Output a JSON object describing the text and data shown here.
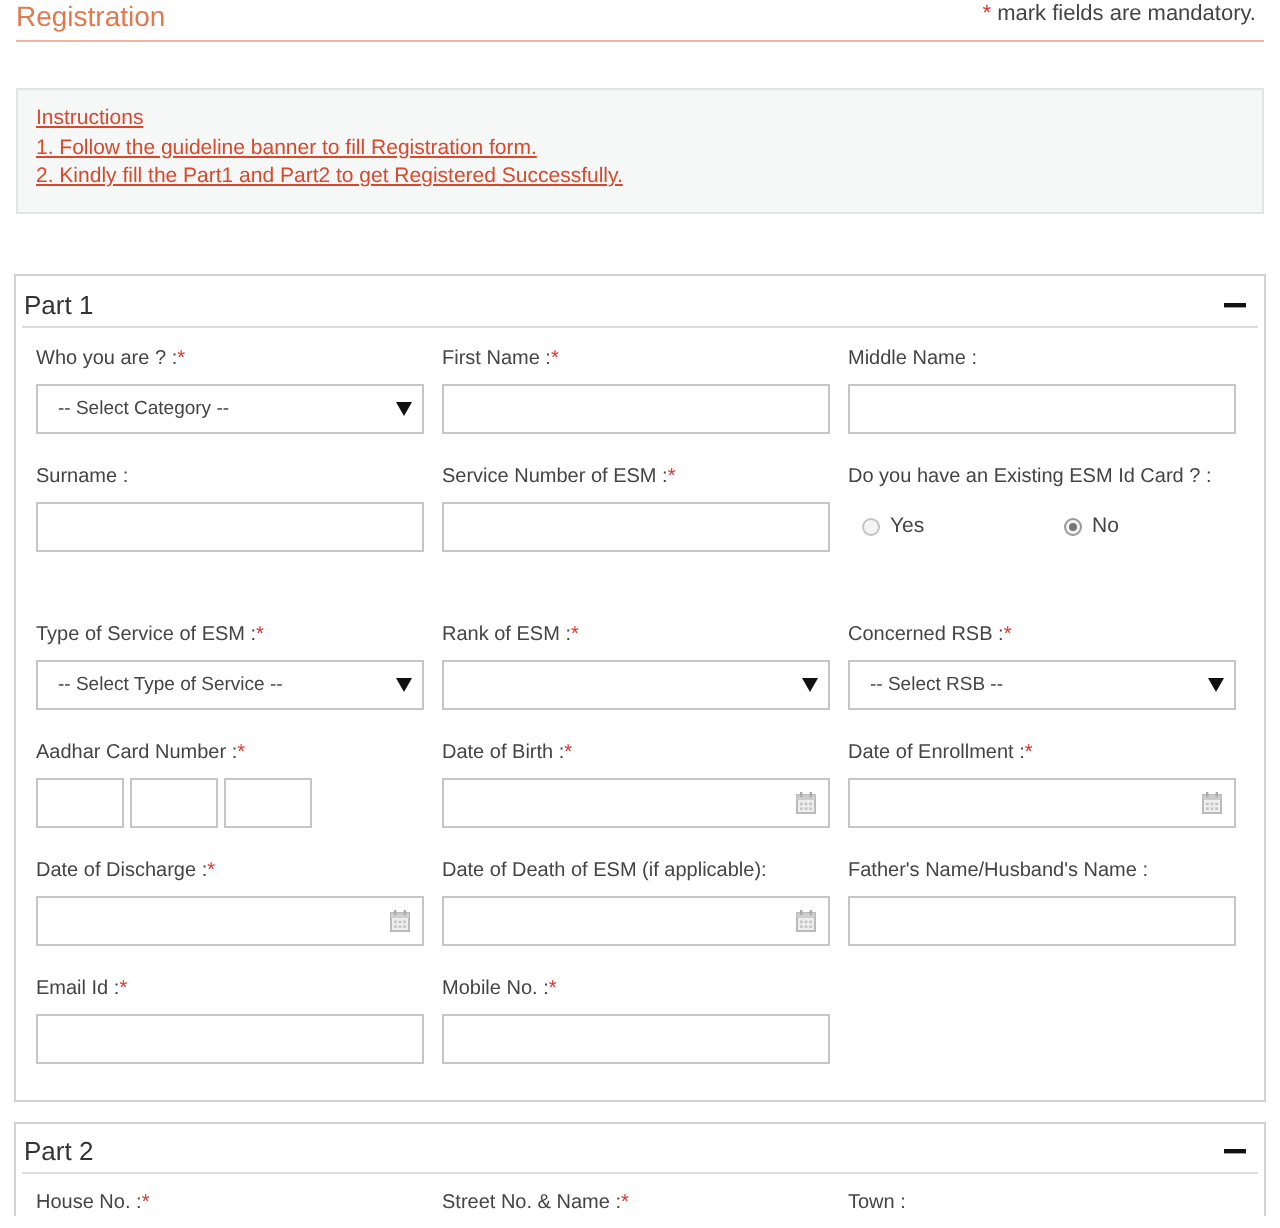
{
  "header": {
    "title": "Registration",
    "note": {
      "mark": "*",
      "text": "mark fields are mandatory."
    }
  },
  "instructions": {
    "title": "Instructions",
    "items": [
      "1. Follow the guideline banner to fill Registration form.",
      "2. Kindly fill the Part1 and Part2 to get Registered Successfully."
    ]
  },
  "parts": [
    {
      "title": "Part 1",
      "expanded": true,
      "fields": [
        {
          "label": "Who you are ? :",
          "mark": "*",
          "kind": "select",
          "value": "-- Select Category --"
        },
        {
          "label": "First Name :",
          "mark": "*",
          "kind": "text"
        },
        {
          "label": "Middle Name :",
          "kind": "text"
        },
        {
          "label": "Surname :",
          "kind": "text"
        },
        {
          "label": "Service Number of ESM :",
          "mark": "*",
          "kind": "text"
        },
        {
          "label": "Do you have an Existing ESM Id Card ? :",
          "kind": "radio",
          "options": [
            {
              "label": "Yes",
              "selected": false
            },
            {
              "label": "No",
              "selected": true
            }
          ]
        },
        {
          "label": "Type of Service of ESM :",
          "mark": "*",
          "kind": "select",
          "value": "-- Select Type of Service --"
        },
        {
          "label": "Rank of ESM :",
          "mark": "*",
          "kind": "select"
        },
        {
          "label": "Concerned RSB :",
          "mark": "*",
          "kind": "select",
          "value": "-- Select RSB --"
        },
        {
          "label": "Aadhar Card Number :",
          "mark": "*",
          "kind": "split"
        },
        {
          "label": "Date of Birth :",
          "mark": "*",
          "kind": "date"
        },
        {
          "label": "Date of Enrollment :",
          "mark": "*",
          "kind": "date"
        },
        {
          "label": "Date of Discharge :",
          "mark": "*",
          "kind": "date"
        },
        {
          "label": "Date of Death of ESM (if applicable):",
          "kind": "date"
        },
        {
          "label": "Father's Name/Husband's Name :",
          "kind": "text"
        },
        {
          "label": "Email Id :",
          "mark": "*",
          "kind": "text"
        },
        {
          "label": "Mobile No. :",
          "mark": "*",
          "kind": "text"
        }
      ]
    },
    {
      "title": "Part 2",
      "expanded": true,
      "fields": [
        {
          "label": "House No. :",
          "mark": "*"
        },
        {
          "label": "Street No. & Name :",
          "mark": "*"
        },
        {
          "label": "Town :"
        }
      ]
    }
  ]
}
